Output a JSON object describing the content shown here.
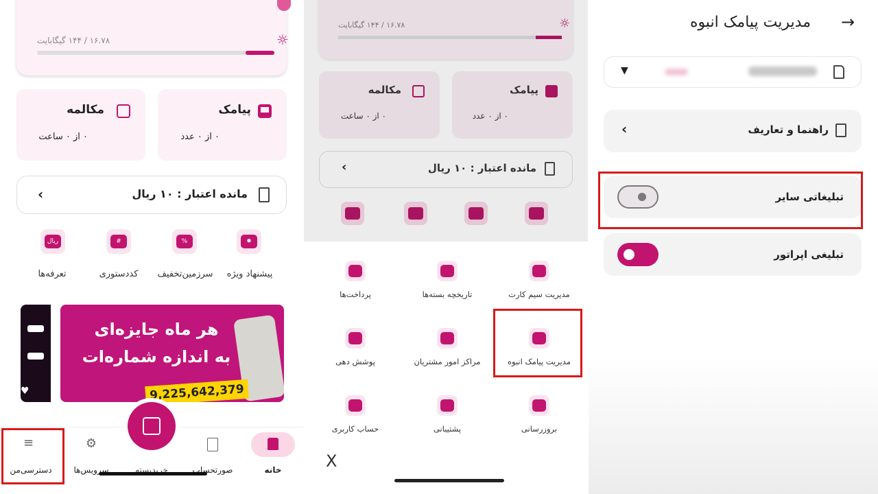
{
  "panel1": {
    "data_usage": "۱۶.۷۸ / ۱۴۴ گیگابایت",
    "sms_title": "پیامک",
    "sms_value": "۰ از ۰ عدد",
    "call_title": "مکالمه",
    "call_value": "۰ از ۰ ساعت",
    "credit_label": "مانده اعتبار :",
    "credit_value": "۱۰ ریال",
    "tiles": [
      {
        "label": "پیشنهاد ویژه",
        "icon": "special-offer-icon",
        "glyph": "✹"
      },
      {
        "label": "سرزمین‌تخفیف",
        "icon": "discount-icon",
        "glyph": "%"
      },
      {
        "label": "کددستوری",
        "icon": "hash-code-icon",
        "glyph": "#"
      },
      {
        "label": "تعرفه‌ها",
        "icon": "tariff-icon",
        "glyph": "ریال"
      }
    ],
    "banner_line1": "هر ماه جایزه‌ای",
    "banner_line2": "به اندازه شماره‌ات",
    "banner_number": "9,225,642,379",
    "nav": {
      "home": "خانه",
      "bills": "صورتحساب",
      "packages": "خریدبسته",
      "services": "سرویس‌ها",
      "access": "دسترسی‌من"
    }
  },
  "panel2": {
    "data_usage": "۱۶.۷۸ / ۱۴۴ گیگابایت",
    "sms_title": "پیامک",
    "sms_value": "۰ از ۰ عدد",
    "call_title": "مکالمه",
    "call_value": "۰ از ۰ ساعت",
    "credit_label": "مانده اعتبار :",
    "credit_value": "۱۰ ریال",
    "services": [
      {
        "label": "مدیریت سیم کارت",
        "icon": "sim-management-icon"
      },
      {
        "label": "تاریخچه بسته‌ها",
        "icon": "package-history-icon"
      },
      {
        "label": "پرداخت‌ها",
        "icon": "payments-icon"
      },
      {
        "label": "مدیریت پیامک انبوه",
        "icon": "bulk-sms-icon"
      },
      {
        "label": "مراکز امور مشتریان",
        "icon": "customer-centers-icon"
      },
      {
        "label": "پوشش دهی",
        "icon": "coverage-icon"
      },
      {
        "label": "بروزرسانی",
        "icon": "update-icon"
      },
      {
        "label": "پشتیبانی",
        "icon": "support-icon"
      },
      {
        "label": "حساب کاربری",
        "icon": "user-account-icon"
      }
    ],
    "close_label": "X"
  },
  "panel3": {
    "title": "مدیریت پیامک انبوه",
    "help_label": "راهنما و تعاریف",
    "toggle_other_label": "تبلیغاتی سایر",
    "toggle_other_state": "off",
    "toggle_operator_label": "تبلیغی اپراتور",
    "toggle_operator_state": "on"
  },
  "colors": {
    "brand": "#c2136f",
    "highlight": "#d61a1a",
    "card": "#fdf0f6"
  }
}
